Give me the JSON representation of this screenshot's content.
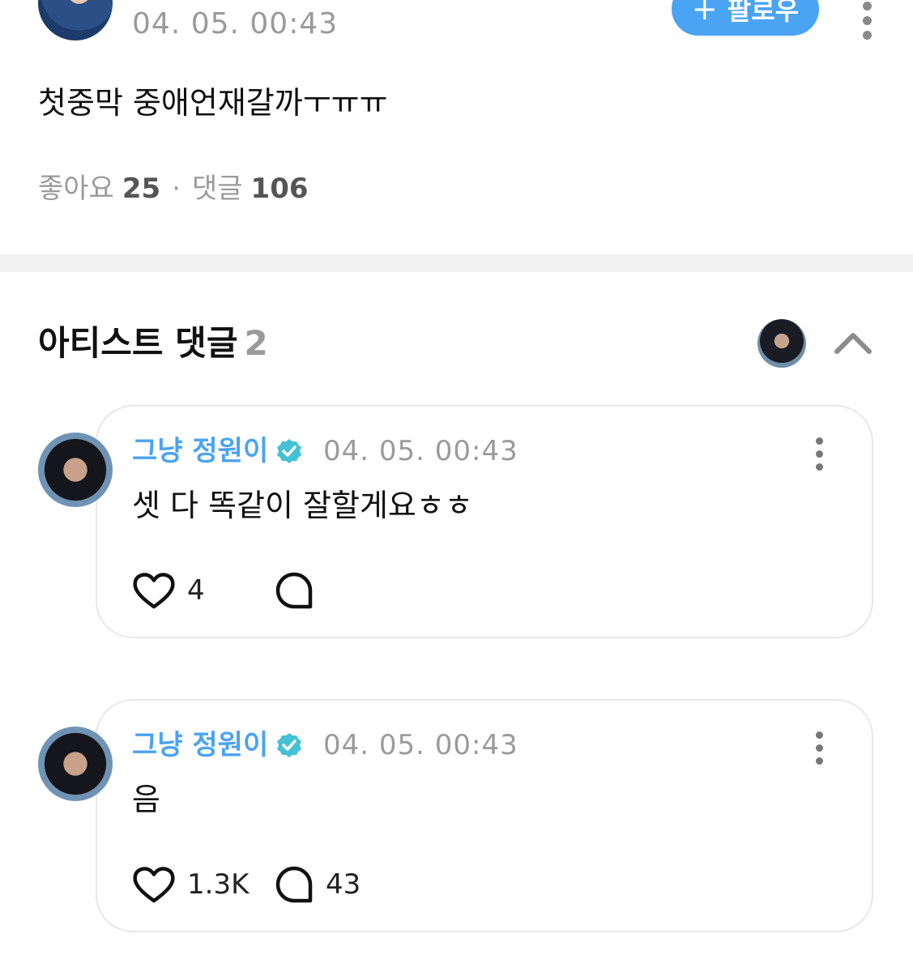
{
  "post": {
    "time": "04. 05. 00:43",
    "follow_label": "팔로우",
    "follow_icon": "+",
    "body": "첫중막 중애언재갈까ㅜㅠㅠ",
    "likes_label": "좋아요",
    "likes_count": "25",
    "separator": "·",
    "comments_label": "댓글",
    "comments_count": "106"
  },
  "artist_section": {
    "title": "아티스트 댓글",
    "count": "2"
  },
  "comments": [
    {
      "name": "그냥 정원이",
      "time": "04. 05. 00:43",
      "text": "셋 다 똑같이 잘할게요ㅎㅎ",
      "likes": "4",
      "replies": ""
    },
    {
      "name": "그냥 정원이",
      "time": "04. 05. 00:43",
      "text": "음",
      "likes": "1.3K",
      "replies": "43"
    }
  ],
  "colors": {
    "accent": "#4aa3f3",
    "verified": "#45c1d6",
    "muted": "#9a9a9a",
    "divider": "#f2f2f2"
  },
  "icons": [
    "plus-icon",
    "kebab-icon",
    "chevron-up-icon",
    "verified-badge-icon",
    "heart-icon",
    "comment-bubble-icon"
  ]
}
